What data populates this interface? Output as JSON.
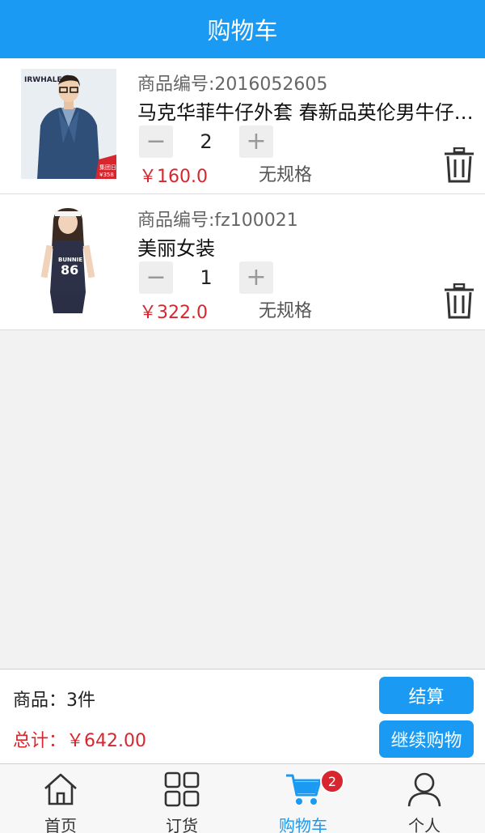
{
  "header": {
    "title": "购物车"
  },
  "cart": {
    "items": [
      {
        "code": "商品编号:2016052605",
        "name": "马克华菲牛仔外套 春新品英伦男牛仔夹克",
        "quantity": "2",
        "price": "￥160.0",
        "spec": "无规格",
        "image_brand": "IRWHALE",
        "image_tag": "集团日",
        "image_price_tag": "¥358"
      },
      {
        "code": "商品编号:fz100021",
        "name": "美丽女装",
        "quantity": "1",
        "price": "￥322.0",
        "spec": "无规格",
        "image_shirt_text": "BUNNIE",
        "image_shirt_number": "86"
      }
    ],
    "minus_symbol": "−",
    "plus_symbol": "+"
  },
  "summary": {
    "count_label": "商品：3件",
    "total_label": "总计：￥642.00",
    "checkout_label": "结算",
    "continue_label": "继续购物"
  },
  "tabbar": {
    "tabs": [
      {
        "label": "首页",
        "icon": "home-icon"
      },
      {
        "label": "订货",
        "icon": "grid-icon"
      },
      {
        "label": "购物车",
        "icon": "cart-icon",
        "active": true
      },
      {
        "label": "个人",
        "icon": "person-icon"
      }
    ],
    "cart_badge": "2"
  },
  "colors": {
    "accent": "#1a9af2",
    "price": "#d8262f",
    "background": "#f2f2f2"
  }
}
